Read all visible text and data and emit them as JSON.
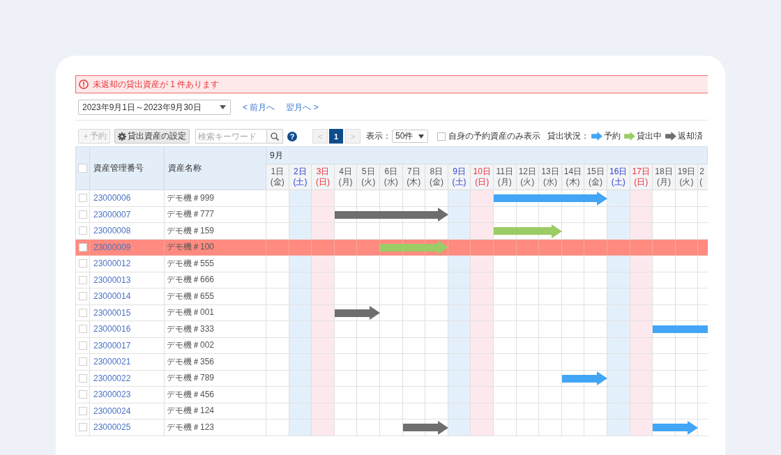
{
  "alert": {
    "message": "未返却の貸出資産が 1 件あります"
  },
  "period": {
    "value": "2023年9月1日～2023年9月30日",
    "prev_link": "< 前月へ",
    "next_link": "翌月へ >"
  },
  "toolbar": {
    "buttons": [
      {
        "kind": "add",
        "label": "＋予約",
        "disabled": true
      },
      {
        "kind": "settings",
        "label": "貸出資産の設定",
        "disabled": false
      }
    ],
    "search": {
      "placeholder": "検索キーワード"
    },
    "help": "?",
    "pagination": {
      "prev": {
        "label": "<",
        "disabled": true
      },
      "pages": [
        {
          "label": "1",
          "selected": true
        }
      ],
      "next": {
        "label": ">",
        "disabled": true
      }
    },
    "page_size": {
      "label": "表示：",
      "value": "50件"
    },
    "own_only": {
      "label": "自身の予約資産のみ表示",
      "checked": false
    },
    "legend": {
      "label": "貸出状況：",
      "items": [
        {
          "kind": "reserved",
          "label": "予約",
          "color": "#42a5f5"
        },
        {
          "kind": "lent",
          "label": "貸出中",
          "color": "#9ccc65"
        },
        {
          "kind": "returned",
          "label": "返却済",
          "color": "#6e6e6e"
        }
      ]
    }
  },
  "table": {
    "select_all": {
      "checked": false
    },
    "columns": [
      {
        "label": "資産管理番号"
      },
      {
        "label": "資産名称"
      }
    ],
    "month": "9月",
    "days": [
      {
        "date": "1日",
        "weekday": "(金)",
        "kind": "weekday"
      },
      {
        "date": "2日",
        "weekday": "(土)",
        "kind": "saturday"
      },
      {
        "date": "3日",
        "weekday": "(日)",
        "kind": "sunday"
      },
      {
        "date": "4日",
        "weekday": "(月)",
        "kind": "weekday"
      },
      {
        "date": "5日",
        "weekday": "(火)",
        "kind": "weekday"
      },
      {
        "date": "6日",
        "weekday": "(水)",
        "kind": "weekday"
      },
      {
        "date": "7日",
        "weekday": "(木)",
        "kind": "weekday"
      },
      {
        "date": "8日",
        "weekday": "(金)",
        "kind": "weekday"
      },
      {
        "date": "9日",
        "weekday": "(土)",
        "kind": "saturday"
      },
      {
        "date": "10日",
        "weekday": "(日)",
        "kind": "sunday"
      },
      {
        "date": "11日",
        "weekday": "(月)",
        "kind": "weekday"
      },
      {
        "date": "12日",
        "weekday": "(火)",
        "kind": "weekday"
      },
      {
        "date": "13日",
        "weekday": "(水)",
        "kind": "weekday"
      },
      {
        "date": "14日",
        "weekday": "(木)",
        "kind": "weekday"
      },
      {
        "date": "15日",
        "weekday": "(金)",
        "kind": "weekday"
      },
      {
        "date": "16日",
        "weekday": "(土)",
        "kind": "saturday"
      },
      {
        "date": "17日",
        "weekday": "(日)",
        "kind": "sunday"
      },
      {
        "date": "18日",
        "weekday": "(月)",
        "kind": "weekday"
      },
      {
        "date": "19日",
        "weekday": "(火)",
        "kind": "weekday"
      },
      {
        "date": "2",
        "weekday": "(",
        "kind": "weekday"
      }
    ],
    "rows": [
      {
        "number": "23000006",
        "name": "デモ機＃999",
        "checked": false,
        "overdue": false,
        "timeline": [
          {
            "kind": "none"
          },
          {
            "kind": "none"
          },
          {
            "kind": "none"
          },
          {
            "kind": "none"
          },
          {
            "kind": "none"
          },
          {
            "kind": "none"
          },
          {
            "kind": "none"
          },
          {
            "kind": "none"
          },
          {
            "kind": "none"
          },
          {
            "kind": "none"
          },
          {
            "kind": "reserved"
          },
          {
            "kind": "reserved"
          },
          {
            "kind": "reserved"
          },
          {
            "kind": "reserved"
          },
          {
            "kind": "reserved"
          },
          {
            "kind": "none"
          },
          {
            "kind": "none"
          },
          {
            "kind": "none"
          },
          {
            "kind": "none"
          },
          {
            "kind": "none"
          }
        ]
      },
      {
        "number": "23000007",
        "name": "デモ機＃777",
        "checked": false,
        "overdue": false,
        "timeline": [
          {
            "kind": "none"
          },
          {
            "kind": "none"
          },
          {
            "kind": "none"
          },
          {
            "kind": "returned"
          },
          {
            "kind": "returned"
          },
          {
            "kind": "returned"
          },
          {
            "kind": "returned"
          },
          {
            "kind": "returned"
          },
          {
            "kind": "none"
          },
          {
            "kind": "none"
          },
          {
            "kind": "none"
          },
          {
            "kind": "none"
          },
          {
            "kind": "none"
          },
          {
            "kind": "none"
          },
          {
            "kind": "none"
          },
          {
            "kind": "none"
          },
          {
            "kind": "none"
          },
          {
            "kind": "none"
          },
          {
            "kind": "none"
          },
          {
            "kind": "none"
          }
        ]
      },
      {
        "number": "23000008",
        "name": "デモ機＃159",
        "checked": false,
        "overdue": false,
        "timeline": [
          {
            "kind": "none"
          },
          {
            "kind": "none"
          },
          {
            "kind": "none"
          },
          {
            "kind": "none"
          },
          {
            "kind": "none"
          },
          {
            "kind": "none"
          },
          {
            "kind": "none"
          },
          {
            "kind": "none"
          },
          {
            "kind": "none"
          },
          {
            "kind": "none"
          },
          {
            "kind": "lent"
          },
          {
            "kind": "lent"
          },
          {
            "kind": "lent"
          },
          {
            "kind": "none"
          },
          {
            "kind": "none"
          },
          {
            "kind": "none"
          },
          {
            "kind": "none"
          },
          {
            "kind": "none"
          },
          {
            "kind": "none"
          },
          {
            "kind": "none"
          }
        ]
      },
      {
        "number": "23000009",
        "name": "デモ機＃100",
        "checked": false,
        "overdue": true,
        "timeline": [
          {
            "kind": "none"
          },
          {
            "kind": "none"
          },
          {
            "kind": "none"
          },
          {
            "kind": "none"
          },
          {
            "kind": "none"
          },
          {
            "kind": "lent"
          },
          {
            "kind": "lent"
          },
          {
            "kind": "lent"
          },
          {
            "kind": "none"
          },
          {
            "kind": "none"
          },
          {
            "kind": "none"
          },
          {
            "kind": "none"
          },
          {
            "kind": "none"
          },
          {
            "kind": "none"
          },
          {
            "kind": "none"
          },
          {
            "kind": "none"
          },
          {
            "kind": "none"
          },
          {
            "kind": "none"
          },
          {
            "kind": "none"
          },
          {
            "kind": "none"
          }
        ]
      },
      {
        "number": "23000012",
        "name": "デモ機＃555",
        "checked": false,
        "overdue": false,
        "timeline": [
          {
            "kind": "none"
          },
          {
            "kind": "none"
          },
          {
            "kind": "none"
          },
          {
            "kind": "none"
          },
          {
            "kind": "none"
          },
          {
            "kind": "none"
          },
          {
            "kind": "none"
          },
          {
            "kind": "none"
          },
          {
            "kind": "none"
          },
          {
            "kind": "none"
          },
          {
            "kind": "none"
          },
          {
            "kind": "none"
          },
          {
            "kind": "none"
          },
          {
            "kind": "none"
          },
          {
            "kind": "none"
          },
          {
            "kind": "none"
          },
          {
            "kind": "none"
          },
          {
            "kind": "none"
          },
          {
            "kind": "none"
          },
          {
            "kind": "none"
          }
        ]
      },
      {
        "number": "23000013",
        "name": "デモ機＃666",
        "checked": false,
        "overdue": false,
        "timeline": [
          {
            "kind": "none"
          },
          {
            "kind": "none"
          },
          {
            "kind": "none"
          },
          {
            "kind": "none"
          },
          {
            "kind": "none"
          },
          {
            "kind": "none"
          },
          {
            "kind": "none"
          },
          {
            "kind": "none"
          },
          {
            "kind": "none"
          },
          {
            "kind": "none"
          },
          {
            "kind": "none"
          },
          {
            "kind": "none"
          },
          {
            "kind": "none"
          },
          {
            "kind": "none"
          },
          {
            "kind": "none"
          },
          {
            "kind": "none"
          },
          {
            "kind": "none"
          },
          {
            "kind": "none"
          },
          {
            "kind": "none"
          },
          {
            "kind": "none"
          }
        ]
      },
      {
        "number": "23000014",
        "name": "デモ機＃655",
        "checked": false,
        "overdue": false,
        "timeline": [
          {
            "kind": "none"
          },
          {
            "kind": "none"
          },
          {
            "kind": "none"
          },
          {
            "kind": "none"
          },
          {
            "kind": "none"
          },
          {
            "kind": "none"
          },
          {
            "kind": "none"
          },
          {
            "kind": "none"
          },
          {
            "kind": "none"
          },
          {
            "kind": "none"
          },
          {
            "kind": "none"
          },
          {
            "kind": "none"
          },
          {
            "kind": "none"
          },
          {
            "kind": "none"
          },
          {
            "kind": "none"
          },
          {
            "kind": "none"
          },
          {
            "kind": "none"
          },
          {
            "kind": "none"
          },
          {
            "kind": "none"
          },
          {
            "kind": "none"
          }
        ]
      },
      {
        "number": "23000015",
        "name": "デモ機＃001",
        "checked": false,
        "overdue": false,
        "timeline": [
          {
            "kind": "none"
          },
          {
            "kind": "none"
          },
          {
            "kind": "none"
          },
          {
            "kind": "returned"
          },
          {
            "kind": "returned"
          },
          {
            "kind": "none"
          },
          {
            "kind": "none"
          },
          {
            "kind": "none"
          },
          {
            "kind": "none"
          },
          {
            "kind": "none"
          },
          {
            "kind": "none"
          },
          {
            "kind": "none"
          },
          {
            "kind": "none"
          },
          {
            "kind": "none"
          },
          {
            "kind": "none"
          },
          {
            "kind": "none"
          },
          {
            "kind": "none"
          },
          {
            "kind": "none"
          },
          {
            "kind": "none"
          },
          {
            "kind": "none"
          }
        ]
      },
      {
        "number": "23000016",
        "name": "デモ機＃333",
        "checked": false,
        "overdue": false,
        "timeline": [
          {
            "kind": "none"
          },
          {
            "kind": "none"
          },
          {
            "kind": "none"
          },
          {
            "kind": "none"
          },
          {
            "kind": "none"
          },
          {
            "kind": "none"
          },
          {
            "kind": "none"
          },
          {
            "kind": "none"
          },
          {
            "kind": "none"
          },
          {
            "kind": "none"
          },
          {
            "kind": "none"
          },
          {
            "kind": "none"
          },
          {
            "kind": "none"
          },
          {
            "kind": "none"
          },
          {
            "kind": "none"
          },
          {
            "kind": "none"
          },
          {
            "kind": "none"
          },
          {
            "kind": "reserved"
          },
          {
            "kind": "reserved"
          },
          {
            "kind": "reserved"
          }
        ]
      },
      {
        "number": "23000017",
        "name": "デモ機＃002",
        "checked": false,
        "overdue": false,
        "timeline": [
          {
            "kind": "none"
          },
          {
            "kind": "none"
          },
          {
            "kind": "none"
          },
          {
            "kind": "none"
          },
          {
            "kind": "none"
          },
          {
            "kind": "none"
          },
          {
            "kind": "none"
          },
          {
            "kind": "none"
          },
          {
            "kind": "none"
          },
          {
            "kind": "none"
          },
          {
            "kind": "none"
          },
          {
            "kind": "none"
          },
          {
            "kind": "none"
          },
          {
            "kind": "none"
          },
          {
            "kind": "none"
          },
          {
            "kind": "none"
          },
          {
            "kind": "none"
          },
          {
            "kind": "none"
          },
          {
            "kind": "none"
          },
          {
            "kind": "none"
          }
        ]
      },
      {
        "number": "23000021",
        "name": "デモ機＃356",
        "checked": false,
        "overdue": false,
        "timeline": [
          {
            "kind": "none"
          },
          {
            "kind": "none"
          },
          {
            "kind": "none"
          },
          {
            "kind": "none"
          },
          {
            "kind": "none"
          },
          {
            "kind": "none"
          },
          {
            "kind": "none"
          },
          {
            "kind": "none"
          },
          {
            "kind": "none"
          },
          {
            "kind": "none"
          },
          {
            "kind": "none"
          },
          {
            "kind": "none"
          },
          {
            "kind": "none"
          },
          {
            "kind": "none"
          },
          {
            "kind": "none"
          },
          {
            "kind": "none"
          },
          {
            "kind": "none"
          },
          {
            "kind": "none"
          },
          {
            "kind": "none"
          },
          {
            "kind": "none"
          }
        ]
      },
      {
        "number": "23000022",
        "name": "デモ機＃789",
        "checked": false,
        "overdue": false,
        "timeline": [
          {
            "kind": "none"
          },
          {
            "kind": "none"
          },
          {
            "kind": "none"
          },
          {
            "kind": "none"
          },
          {
            "kind": "none"
          },
          {
            "kind": "none"
          },
          {
            "kind": "none"
          },
          {
            "kind": "none"
          },
          {
            "kind": "none"
          },
          {
            "kind": "none"
          },
          {
            "kind": "none"
          },
          {
            "kind": "none"
          },
          {
            "kind": "none"
          },
          {
            "kind": "reserved"
          },
          {
            "kind": "reserved"
          },
          {
            "kind": "none"
          },
          {
            "kind": "none"
          },
          {
            "kind": "none"
          },
          {
            "kind": "none"
          },
          {
            "kind": "none"
          }
        ]
      },
      {
        "number": "23000023",
        "name": "デモ機＃456",
        "checked": false,
        "overdue": false,
        "timeline": [
          {
            "kind": "none"
          },
          {
            "kind": "none"
          },
          {
            "kind": "none"
          },
          {
            "kind": "none"
          },
          {
            "kind": "none"
          },
          {
            "kind": "none"
          },
          {
            "kind": "none"
          },
          {
            "kind": "none"
          },
          {
            "kind": "none"
          },
          {
            "kind": "none"
          },
          {
            "kind": "none"
          },
          {
            "kind": "none"
          },
          {
            "kind": "none"
          },
          {
            "kind": "none"
          },
          {
            "kind": "none"
          },
          {
            "kind": "none"
          },
          {
            "kind": "none"
          },
          {
            "kind": "none"
          },
          {
            "kind": "none"
          },
          {
            "kind": "none"
          }
        ]
      },
      {
        "number": "23000024",
        "name": "デモ機＃124",
        "checked": false,
        "overdue": false,
        "timeline": [
          {
            "kind": "none"
          },
          {
            "kind": "none"
          },
          {
            "kind": "none"
          },
          {
            "kind": "none"
          },
          {
            "kind": "none"
          },
          {
            "kind": "none"
          },
          {
            "kind": "none"
          },
          {
            "kind": "none"
          },
          {
            "kind": "none"
          },
          {
            "kind": "none"
          },
          {
            "kind": "none"
          },
          {
            "kind": "none"
          },
          {
            "kind": "none"
          },
          {
            "kind": "none"
          },
          {
            "kind": "none"
          },
          {
            "kind": "none"
          },
          {
            "kind": "none"
          },
          {
            "kind": "none"
          },
          {
            "kind": "none"
          },
          {
            "kind": "none"
          }
        ]
      },
      {
        "number": "23000025",
        "name": "デモ機＃123",
        "checked": false,
        "overdue": false,
        "timeline": [
          {
            "kind": "none"
          },
          {
            "kind": "none"
          },
          {
            "kind": "none"
          },
          {
            "kind": "none"
          },
          {
            "kind": "none"
          },
          {
            "kind": "none"
          },
          {
            "kind": "returned"
          },
          {
            "kind": "returned"
          },
          {
            "kind": "none"
          },
          {
            "kind": "none"
          },
          {
            "kind": "none"
          },
          {
            "kind": "none"
          },
          {
            "kind": "none"
          },
          {
            "kind": "none"
          },
          {
            "kind": "none"
          },
          {
            "kind": "none"
          },
          {
            "kind": "none"
          },
          {
            "kind": "reserved"
          },
          {
            "kind": "reserved"
          },
          {
            "kind": "none"
          }
        ]
      }
    ]
  }
}
